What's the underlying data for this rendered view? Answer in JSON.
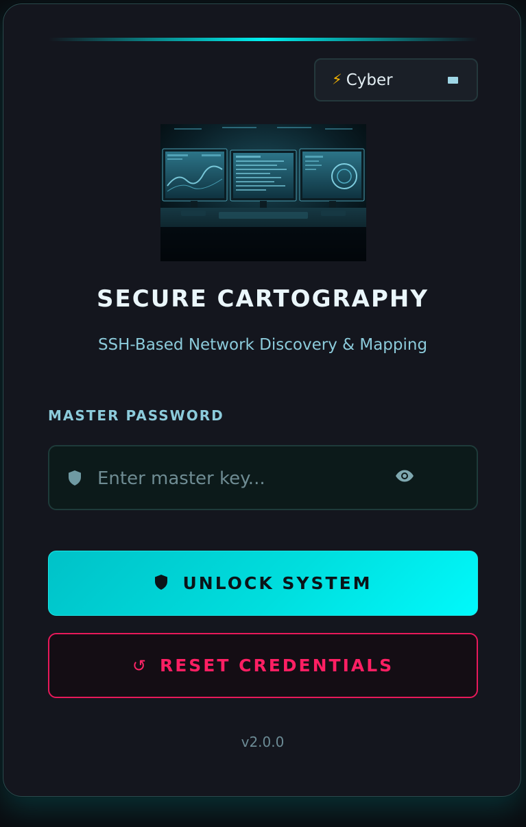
{
  "theme": {
    "icon": "lightning-bolt-icon",
    "label": "Cyber",
    "indicator_icon": "dropdown-indicator-icon"
  },
  "header": {
    "title": "SECURE CARTOGRAPHY",
    "subtitle": "SSH-Based Network Discovery & Mapping"
  },
  "form": {
    "password_label": "MASTER PASSWORD",
    "password_placeholder": "Enter master key...",
    "password_value": "",
    "field_icon": "shield-icon",
    "visibility_icon": "eye-icon"
  },
  "actions": {
    "unlock_label": "UNLOCK SYSTEM",
    "unlock_icon": "shield-icon",
    "reset_label": "RESET CREDENTIALS",
    "reset_icon": "refresh-icon"
  },
  "footer": {
    "version": "v2.0.0"
  },
  "colors": {
    "accent": "#00e5e5",
    "danger": "#ff1f63",
    "card_bg": "#14161e",
    "text_muted": "#8ccbdb"
  }
}
